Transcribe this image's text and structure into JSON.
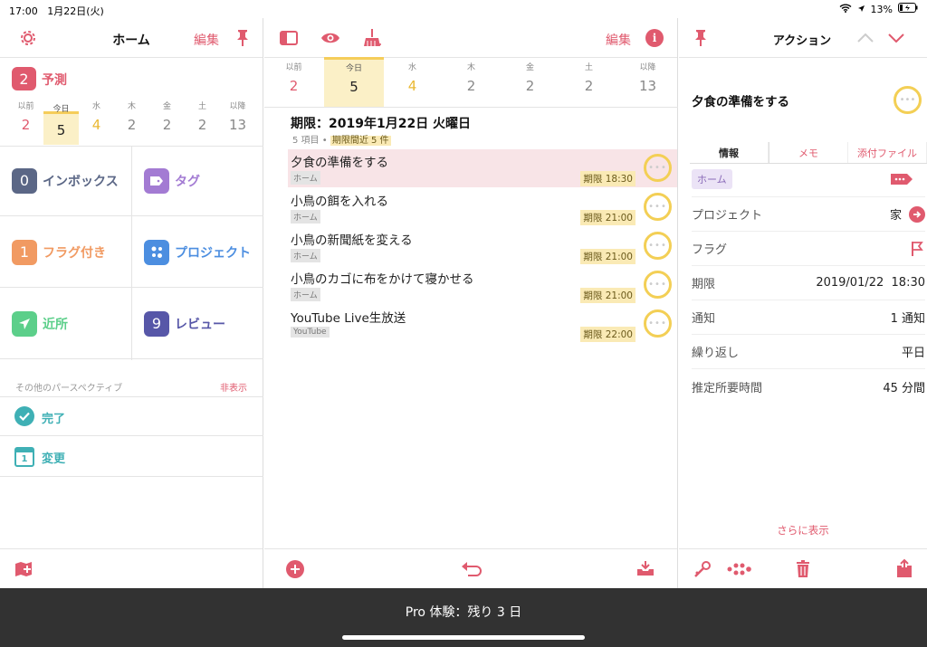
{
  "status": {
    "time": "17:00",
    "date": "1月22日(火)",
    "battery": "13%"
  },
  "left": {
    "title": "ホーム",
    "edit": "編集",
    "forecast": {
      "count": "2",
      "label": "予測"
    },
    "days": [
      {
        "label": "以前",
        "num": "2"
      },
      {
        "label": "今日",
        "num": "5"
      },
      {
        "label": "水",
        "num": "4"
      },
      {
        "label": "木",
        "num": "2"
      },
      {
        "label": "金",
        "num": "2"
      },
      {
        "label": "土",
        "num": "2"
      },
      {
        "label": "以降",
        "num": "13"
      }
    ],
    "tiles": [
      {
        "count": "0",
        "label": "インボックス"
      },
      {
        "label": "タグ"
      },
      {
        "count": "1",
        "label": "フラグ付き"
      },
      {
        "label": "プロジェクト"
      },
      {
        "label": "近所"
      },
      {
        "count": "9",
        "label": "レビュー"
      }
    ],
    "other_header": "その他のパースペクティブ",
    "hide": "非表示",
    "extra": [
      {
        "label": "完了"
      },
      {
        "label": "変更",
        "icon_text": "1"
      }
    ]
  },
  "mid": {
    "edit": "編集",
    "days": [
      {
        "label": "以前",
        "num": "2"
      },
      {
        "label": "今日",
        "num": "5"
      },
      {
        "label": "水",
        "num": "4"
      },
      {
        "label": "木",
        "num": "2"
      },
      {
        "label": "金",
        "num": "2"
      },
      {
        "label": "土",
        "num": "2"
      },
      {
        "label": "以降",
        "num": "13"
      }
    ],
    "section_title": "期限：2019年1月22日 火曜日",
    "section_count": "5 項目",
    "section_dot": "•",
    "section_due": "期限間近 5 件",
    "tasks": [
      {
        "title": "夕食の準備をする",
        "tag": "ホーム",
        "due": "期限 18:30"
      },
      {
        "title": "小鳥の餌を入れる",
        "tag": "ホーム",
        "due": "期限 21:00"
      },
      {
        "title": "小鳥の新聞紙を変える",
        "tag": "ホーム",
        "due": "期限 21:00"
      },
      {
        "title": "小鳥のカゴに布をかけて寝かせる",
        "tag": "ホーム",
        "due": "期限 21:00"
      },
      {
        "title": "YouTube Live生放送",
        "tag": "YouTube",
        "due": "期限 22:00"
      }
    ]
  },
  "right": {
    "title": "アクション",
    "task_title": "夕食の準備をする",
    "tabs": [
      "情報",
      "メモ",
      "添付ファイル"
    ],
    "tag": "ホーム",
    "rows": [
      {
        "label": "プロジェクト",
        "value": "家"
      },
      {
        "label": "フラグ",
        "value": ""
      },
      {
        "label": "期限",
        "value": "2019/01/22  18:30"
      },
      {
        "label": "通知",
        "value": "1 通知"
      },
      {
        "label": "繰り返し",
        "value": "平日"
      },
      {
        "label": "推定所要時間",
        "value": "45 分間"
      }
    ],
    "more": "さらに表示"
  },
  "pro_banner": "Pro 体験：残り 3 日",
  "colors": {
    "accent": "#e05a6e",
    "today": "#f5cd5a",
    "inbox": "#5b6786",
    "tag": "#a37bd3",
    "flag": "#f19a62",
    "project": "#4c8ee0",
    "nearby": "#5ccf8a",
    "review": "#5757a8",
    "teal": "#3fb0b5"
  }
}
